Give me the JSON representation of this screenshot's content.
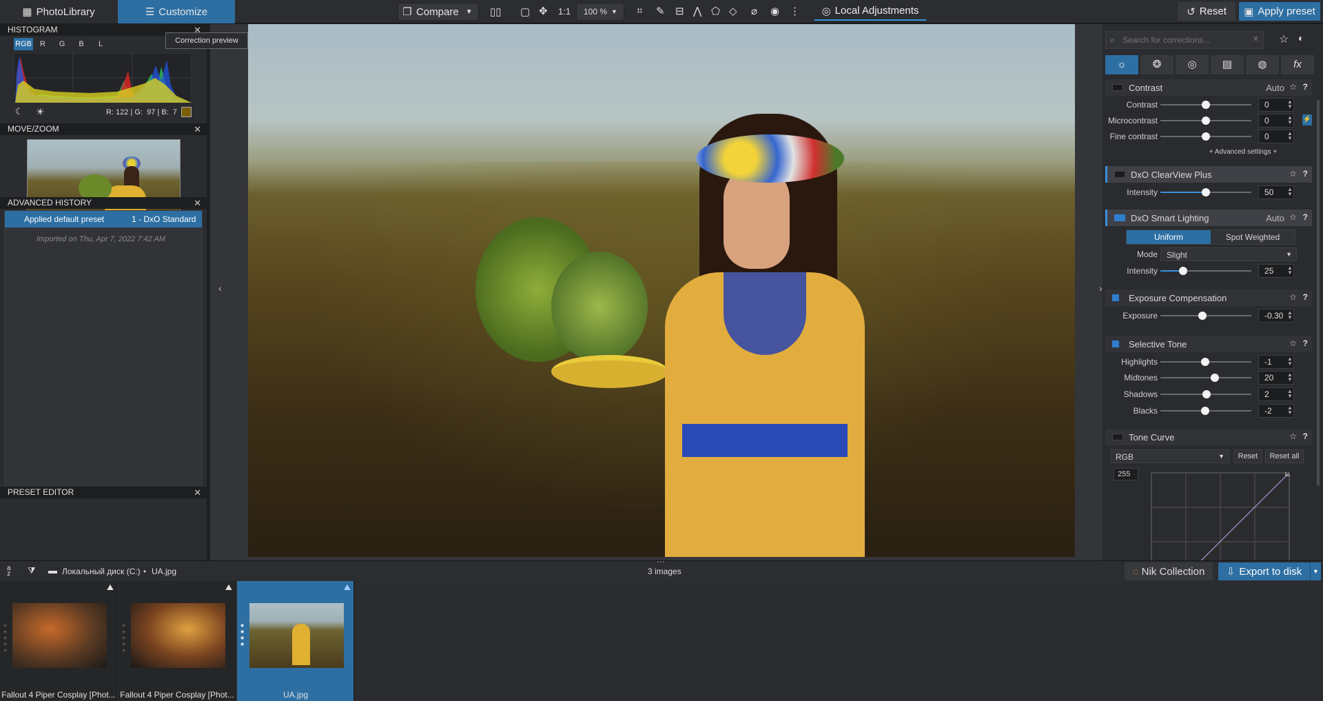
{
  "topbar": {
    "photolibrary": "PhotoLibrary",
    "customize": "Customize",
    "compare": "Compare",
    "one_to_one": "1:1",
    "zoom": "100 %",
    "local_adjustments": "Local Adjustments",
    "reset": "Reset",
    "apply_preset": "Apply preset"
  },
  "histogram": {
    "title": "HISTOGRAM",
    "channels": [
      "RGB",
      "R",
      "G",
      "B",
      "L"
    ],
    "readout": "R: 122 | G:  97 | B:  7",
    "swatch_color": "#7a6107"
  },
  "movezoom": {
    "title": "MOVE/ZOOM"
  },
  "history": {
    "title": "ADVANCED HISTORY",
    "entry_action": "Applied default preset",
    "entry_preset": "1 - DxO Standard",
    "imported": "Imported on Thu, Apr 7, 2022 7:42 AM"
  },
  "preset_editor": {
    "title": "PRESET EDITOR"
  },
  "viewer": {
    "tooltip": "Correction preview"
  },
  "right": {
    "search_placeholder": "Search for corrections...",
    "contrast": {
      "title": "Contrast",
      "auto": "Auto",
      "rows": [
        {
          "label": "Contrast",
          "value": "0",
          "pos": 0.5
        },
        {
          "label": "Microcontrast",
          "value": "0",
          "pos": 0.5
        },
        {
          "label": "Fine contrast",
          "value": "0",
          "pos": 0.5
        }
      ],
      "advanced": "+ Advanced settings +"
    },
    "clearview": {
      "title": "DxO ClearView Plus",
      "rows": [
        {
          "label": "Intensity",
          "value": "50",
          "pos": 0.5
        }
      ]
    },
    "smartlighting": {
      "title": "DxO Smart Lighting",
      "auto": "Auto",
      "uniform": "Uniform",
      "spot": "Spot Weighted",
      "mode_label": "Mode",
      "mode_value": "Slight",
      "rows": [
        {
          "label": "Intensity",
          "value": "25",
          "pos": 0.25
        }
      ]
    },
    "exposure": {
      "title": "Exposure Compensation",
      "rows": [
        {
          "label": "Exposure",
          "value": "-0.30",
          "pos": 0.46
        }
      ]
    },
    "selectivetone": {
      "title": "Selective Tone",
      "rows": [
        {
          "label": "Highlights",
          "value": "-1",
          "pos": 0.49
        },
        {
          "label": "Midtones",
          "value": "20",
          "pos": 0.6
        },
        {
          "label": "Shadows",
          "value": "2",
          "pos": 0.51
        },
        {
          "label": "Blacks",
          "value": "-2",
          "pos": 0.49
        }
      ]
    },
    "tonecurve": {
      "title": "Tone Curve",
      "channel": "RGB",
      "reset": "Reset",
      "reset_all": "Reset all",
      "top_value": "255"
    }
  },
  "pathbar": {
    "path": "Локальный диск (C:)",
    "file": "UA.jpg",
    "count": "3 images",
    "nik": "Nik Collection",
    "export": "Export to disk"
  },
  "filmstrip": [
    {
      "name": "Fallout 4 Piper Cosplay [Phot...",
      "stars": 0
    },
    {
      "name": "Fallout 4 Piper Cosplay [Phot...",
      "stars": 0
    },
    {
      "name": "UA.jpg",
      "stars": 4
    }
  ]
}
